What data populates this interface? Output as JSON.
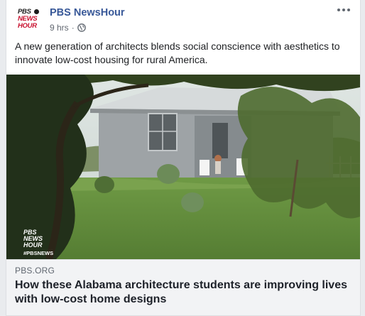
{
  "post": {
    "author": "PBS NewsHour",
    "avatar_lines": [
      "PBS",
      "NEWS",
      "HOUR"
    ],
    "timestamp": "9 hrs",
    "separator": "·",
    "privacy_icon": "globe-icon",
    "text": "A new generation of architects blends social conscience with aesthetics to innovate low-cost housing for rural America."
  },
  "photo": {
    "watermark_lines": [
      "PBS",
      "NEWS",
      "HOUR"
    ],
    "watermark_tag": "#PBSNEWS"
  },
  "link": {
    "domain": "PBS.ORG",
    "headline": "How these Alabama architecture students are improving lives with low-cost home designs"
  },
  "colors": {
    "author_blue": "#385898",
    "pbs_red": "#c8102e",
    "link_bg": "#f2f3f5"
  }
}
